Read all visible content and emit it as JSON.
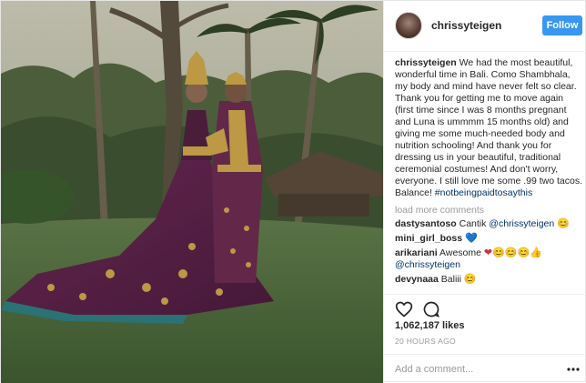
{
  "post": {
    "username": "chrissyteigen",
    "follow_label": "Follow",
    "caption": {
      "username": "chrissyteigen",
      "text": "We had the most beautiful, wonderful time in Bali. Como Shambhala, my body and mind have never felt so clear. Thank you for getting me to move again (first time since I was 8 months pregnant and Luna is ummmm 15 months old) and giving me some much-needed body and nutrition schooling! And thank you for dressing us in your beautiful, traditional ceremonial costumes! And don't worry, everyone. I still love me some .99 two tacos. Balance! ",
      "hashtag": "#notbeingpaidtosaythis"
    },
    "load_more": "load more comments",
    "comments": [
      {
        "user": "dastysantoso",
        "text": "Cantik ",
        "mention": "@chrissyteigen",
        "emoji": "😊"
      },
      {
        "user": "mini_girl_boss",
        "text": "",
        "mention": "",
        "emoji": "💙"
      },
      {
        "user": "arikariani",
        "text": "Awesome ",
        "emoji": "❤😊😊😊👍",
        "mention": "@chrissyteigen"
      },
      {
        "user": "devynaaa",
        "text": "Baliii ",
        "mention": "",
        "emoji": "😊"
      }
    ],
    "likes": "1,062,187 likes",
    "timestamp": "20 HOURS AGO",
    "add_comment_placeholder": "Add a comment...",
    "icons": {
      "like": "heart-icon",
      "comment": "comment-icon",
      "more": "more-options-icon"
    },
    "colors": {
      "follow_bg": "#3897f0",
      "mention": "#003569",
      "muted": "#999999"
    }
  }
}
